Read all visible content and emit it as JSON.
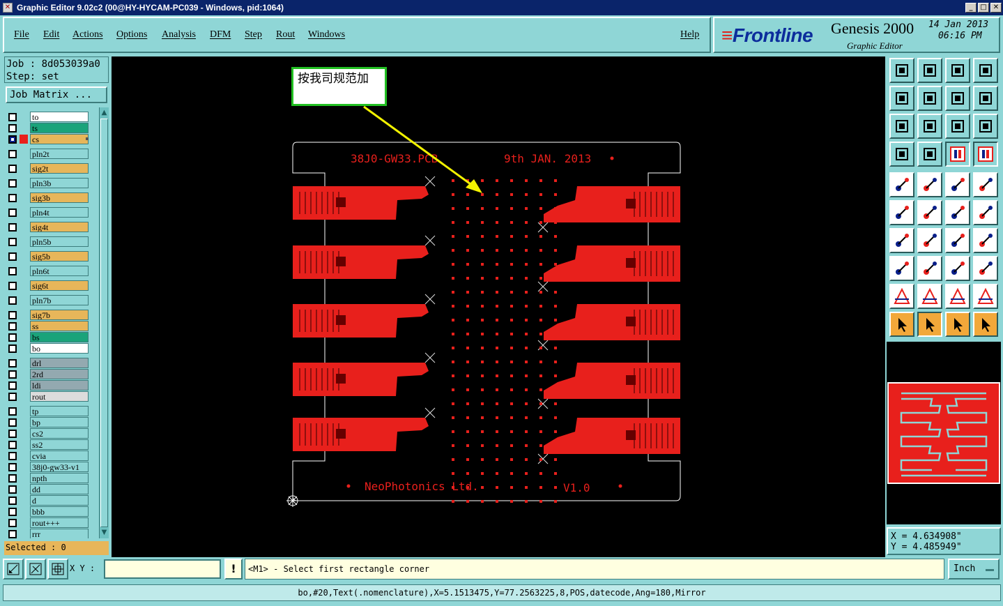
{
  "window": {
    "title": "Graphic Editor 9.02c2 (00@HY-HYCAM-PC039 - Windows, pid:1064)"
  },
  "menu": {
    "items": [
      "File",
      "Edit",
      "Actions",
      "Options",
      "Analysis",
      "DFM",
      "Step",
      "Rout",
      "Windows"
    ],
    "help": "Help"
  },
  "brand": {
    "logo": "Frontline",
    "product": "Genesis 2000",
    "subtitle": "Graphic Editor",
    "date": "14 Jan 2013",
    "time": "06:16 PM"
  },
  "job": {
    "job_line": "Job : 8d053039a0",
    "step_line": "Step: set",
    "matrix_button": "Job Matrix ..."
  },
  "layers": [
    {
      "name": "to",
      "color": "#ffffff"
    },
    {
      "name": "ts",
      "color": "#1aa37a"
    },
    {
      "name": "cs",
      "color": "#e7b65a",
      "active": true
    },
    {
      "name": "pln2t",
      "color": "#8fd6d6"
    },
    {
      "name": "sig2t",
      "color": "#e7b65a"
    },
    {
      "name": "pln3b",
      "color": "#8fd6d6"
    },
    {
      "name": "sig3b",
      "color": "#e7b65a"
    },
    {
      "name": "pln4t",
      "color": "#8fd6d6"
    },
    {
      "name": "sig4t",
      "color": "#e7b65a"
    },
    {
      "name": "pln5b",
      "color": "#8fd6d6"
    },
    {
      "name": "sig5b",
      "color": "#e7b65a"
    },
    {
      "name": "pln6t",
      "color": "#8fd6d6"
    },
    {
      "name": "sig6t",
      "color": "#e7b65a"
    },
    {
      "name": "pln7b",
      "color": "#8fd6d6"
    },
    {
      "name": "sig7b",
      "color": "#e7b65a"
    },
    {
      "name": "ss",
      "color": "#e7b65a"
    },
    {
      "name": "bs",
      "color": "#1aa37a"
    },
    {
      "name": "bo",
      "color": "#ffffff"
    },
    {
      "name": "drl",
      "color": "#93a9b0"
    },
    {
      "name": "2rd",
      "color": "#93a9b0"
    },
    {
      "name": "ldi",
      "color": "#93a9b0"
    },
    {
      "name": "rout",
      "color": "#dcdcdc"
    },
    {
      "name": "tp",
      "color": "#8fd6d6"
    },
    {
      "name": "bp",
      "color": "#8fd6d6"
    },
    {
      "name": "cs2",
      "color": "#8fd6d6"
    },
    {
      "name": "ss2",
      "color": "#8fd6d6"
    },
    {
      "name": "cvia",
      "color": "#8fd6d6"
    },
    {
      "name": "38j0-gw33-v1",
      "color": "#8fd6d6"
    },
    {
      "name": "npth",
      "color": "#8fd6d6"
    },
    {
      "name": "dd",
      "color": "#8fd6d6"
    },
    {
      "name": "d",
      "color": "#8fd6d6"
    },
    {
      "name": "bbb",
      "color": "#8fd6d6"
    },
    {
      "name": "rout+++",
      "color": "#8fd6d6"
    },
    {
      "name": "rrr",
      "color": "#8fd6d6"
    }
  ],
  "selected": "Selected : 0",
  "board": {
    "top_text": "38J0-GW33.PCB",
    "date_text": "9th JAN. 2013",
    "company_text": "NeoPhotonics Ltd.",
    "version_text": "V1.0",
    "copper_color": "#e8201c"
  },
  "callout": {
    "text": "按我司规范加"
  },
  "coords": {
    "x": "X = 4.634908\"",
    "y": "Y = 4.485949\""
  },
  "command": {
    "xy_label": "X Y :",
    "xy_value": "",
    "bang": "!",
    "message": "<M1> - Select first rectangle corner",
    "unit": "Inch"
  },
  "status": "bo,#20,Text(.nomenclature),X=5.1513475,Y=77.2563225,8,POS,datecode,Ang=180,Mirror"
}
